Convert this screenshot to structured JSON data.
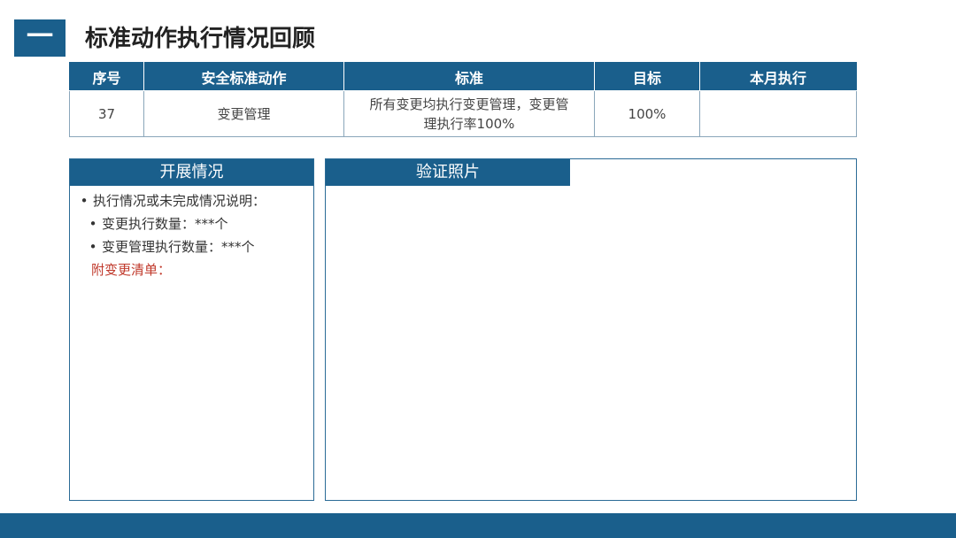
{
  "header": {
    "section_number": "一",
    "title": "标准动作执行情况回顾"
  },
  "table": {
    "columns": [
      "序号",
      "安全标准动作",
      "标准",
      "目标",
      "本月执行"
    ],
    "rows": [
      {
        "no": "37",
        "action": "变更管理",
        "standard_line1": "所有变更均执行变更管理，变更管",
        "standard_line2": "理执行率100%",
        "target": "100%",
        "executed": ""
      }
    ]
  },
  "progress_panel": {
    "title": "开展情况",
    "item1": "执行情况或未完成情况说明：",
    "item2": "变更执行数量：***个",
    "item3": "变更管理执行数量：***个",
    "attachment_note": "附变更清单："
  },
  "photo_panel": {
    "title": "验证照片"
  },
  "colors": {
    "primary": "#1a5f8c",
    "accent_red": "#c0392b",
    "border": "#8aa6ba"
  }
}
